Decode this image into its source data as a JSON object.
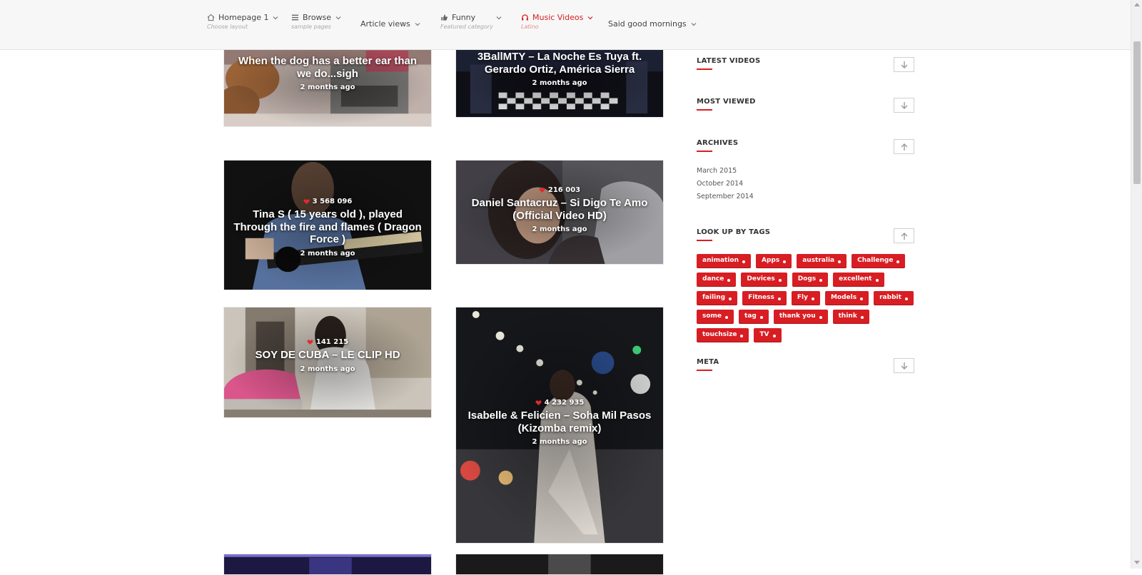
{
  "nav": {
    "items": [
      {
        "label": "Homepage 1",
        "sub": "Choose layout",
        "icon": "home-icon"
      },
      {
        "label": "Browse",
        "sub": "sample pages",
        "icon": "list-icon"
      },
      {
        "label": "Article views",
        "sub": "",
        "icon": ""
      },
      {
        "label": "Funny",
        "sub": "Featured category",
        "icon": "thumbs-up-icon"
      },
      {
        "label": "Music Videos",
        "sub": "Latino",
        "icon": "headphones-icon",
        "active": true
      },
      {
        "label": "Said good mornings",
        "sub": "",
        "icon": ""
      }
    ],
    "accent_color": "#d81e23"
  },
  "videos": [
    {
      "title": "When the dog has a better ear than we do...sigh",
      "views": "",
      "date": "2 months ago"
    },
    {
      "title": "3BallMTY – La Noche Es Tuya ft. Gerardo Ortiz, América Sierra",
      "views": "",
      "date": "2 months ago"
    },
    {
      "title": "Tina S ( 15 years old ), played Through the fire and flames ( Dragon Force )",
      "views": "3 568 096",
      "date": "2 months ago"
    },
    {
      "title": "Daniel Santacruz – Si Digo Te Amo (Official Video HD)",
      "views": "216 003",
      "date": "2 months ago"
    },
    {
      "title": "SOY DE CUBA – LE CLIP HD",
      "views": "141 215",
      "date": "2 months ago"
    },
    {
      "title": "Isabelle & Felicien – Soha Mil Pasos (Kizomba remix)",
      "views": "4 232 935",
      "date": "2 months ago"
    }
  ],
  "sidebar": {
    "latest_videos": "LATEST VIDEOS",
    "most_viewed": "MOST VIEWED",
    "archives": "ARCHIVES",
    "archive_links": [
      "March 2015",
      "October 2014",
      "September 2014"
    ],
    "tags_title": "LOOK UP BY TAGS",
    "tags": [
      "animation",
      "Apps",
      "australia",
      "Challenge",
      "dance",
      "Devices",
      "Dogs",
      "excellent",
      "failing",
      "Fitness",
      "Fly",
      "Models",
      "rabbit",
      "some",
      "tag",
      "thank you",
      "think",
      "touchsize",
      "TV"
    ],
    "meta": "META"
  }
}
